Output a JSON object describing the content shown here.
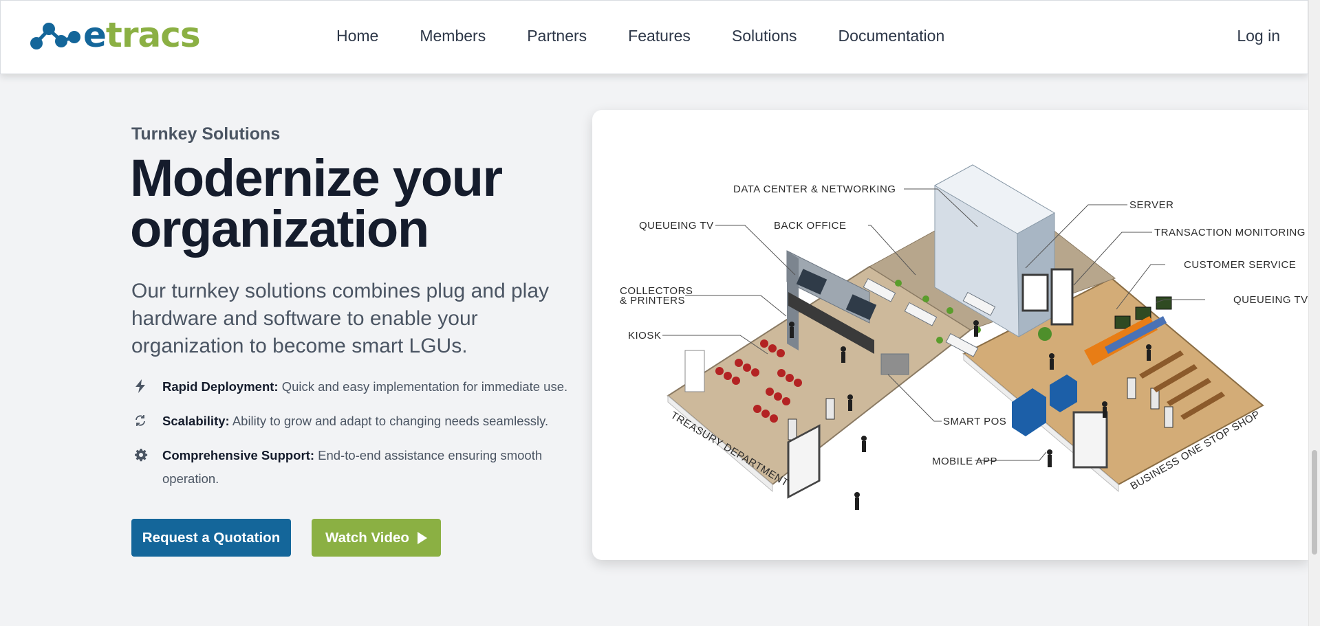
{
  "brand": {
    "logo_text_e": "e",
    "logo_text_rest": "tracs",
    "colors": {
      "blue": "#14669a",
      "green": "#8bb043"
    }
  },
  "nav": {
    "items": [
      "Home",
      "Members",
      "Partners",
      "Features",
      "Solutions",
      "Documentation"
    ],
    "login": "Log in"
  },
  "hero": {
    "eyebrow": "Turnkey Solutions",
    "title": "Modernize your organization",
    "description": "Our turnkey solutions combines plug and play hardware and software to enable your organization to become smart LGUs.",
    "features": [
      {
        "icon": "lightning-icon",
        "title": "Rapid Deployment:",
        "text": "Quick and easy implementation for immediate use."
      },
      {
        "icon": "refresh-icon",
        "title": "Scalability:",
        "text": "Ability to grow and adapt to changing needs seamlessly."
      },
      {
        "icon": "gear-icon",
        "title": "Comprehensive Support:",
        "text": "End-to-end assistance ensuring smooth operation."
      }
    ],
    "buttons": {
      "quote": "Request a Quotation",
      "video": "Watch Video"
    }
  },
  "illustration": {
    "labels": {
      "data_center": "DATA CENTER & NETWORKING",
      "server": "SERVER",
      "queueing_tv_left": "QUEUEING TV",
      "back_office": "BACK OFFICE",
      "transaction_monitoring": "TRANSACTION MONITORING",
      "collectors_1": "COLLECTORS",
      "collectors_2": "& PRINTERS",
      "customer_service": "CUSTOMER SERVICE",
      "queueing_tv_right": "QUEUEING TV",
      "kiosk": "KIOSK",
      "smart_pos": "SMART POS",
      "mobile_app": "MOBILE APP",
      "treasury": "TREASURY DEPARTMENT",
      "one_stop": "BUSINESS ONE STOP SHOP"
    }
  }
}
